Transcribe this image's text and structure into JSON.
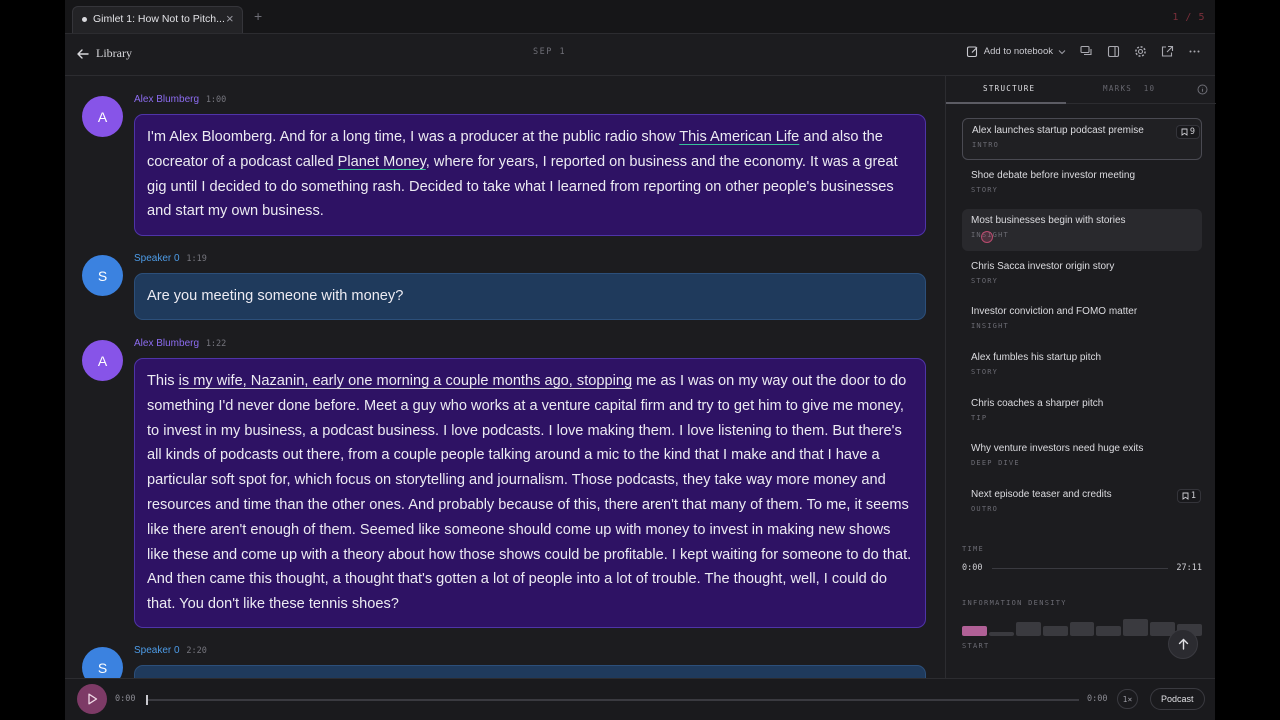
{
  "tabbar": {
    "tab_title": "Gimlet 1: How Not to Pitch...",
    "close_glyph": "×",
    "new_tab_glyph": "+",
    "page_counter": "1 / 5"
  },
  "header": {
    "back_label": "Library",
    "date": "SEP 1",
    "add_to_notebook": "Add to notebook"
  },
  "transcript": {
    "messages": [
      {
        "speaker": "Alex Blumberg",
        "initial": "A",
        "time": "1:00",
        "parts": [
          "I'm Alex Bloomberg. And for a long time, I was a producer at the public radio show ",
          "This American Life",
          " and also the cocreator of a podcast called ",
          "Planet Money",
          ", where for years, I reported on business and the economy. It was a great gig until I decided to do something rash. Decided to take what I learned from reporting on other people's businesses and start my own business."
        ]
      },
      {
        "speaker": "Speaker 0",
        "initial": "S",
        "time": "1:19",
        "text": "Are you meeting someone with money?"
      },
      {
        "speaker": "Alex Blumberg",
        "initial": "A",
        "time": "1:22",
        "parts": [
          "This ",
          "is my wife, Nazanin, early one morning a couple months ago, stopping",
          " me as I was on my way out the door to do something I'd never done before. Meet a guy who works at a venture capital firm and try to get him to give me money, to invest in my business, a podcast business. I love podcasts. I love making them. I love listening to them. But there's all kinds of podcasts out there, from a couple people talking around a mic to the kind that I make and that I have a particular soft spot for, which focus on storytelling and journalism. Those podcasts, they take way more money and resources and time than the other ones. And probably because of this, there aren't that many of them. To me, it seems like there aren't enough of them. Seemed like someone should come up with money to invest in making new shows like these and come up with a theory about how those shows could be profitable. I kept waiting for someone to do that. And then came this thought, a thought that's gotten a lot of people into a lot of trouble. The thought, well, I could do that. You don't like these tennis shoes?"
        ]
      },
      {
        "speaker": "Speaker 0",
        "initial": "S",
        "time": "2:20"
      }
    ]
  },
  "panel": {
    "tab_structure": "STRUCTURE",
    "tab_marks": "MARKS  10",
    "sections": [
      {
        "title": "Alex launches startup podcast premise",
        "category": "INTRO",
        "marks": "9"
      },
      {
        "title": "Shoe debate before investor meeting",
        "category": "STORY"
      },
      {
        "title": "Most businesses begin with stories",
        "category": "INSIGHT"
      },
      {
        "title": "Chris Sacca investor origin story",
        "category": "STORY"
      },
      {
        "title": "Investor conviction and FOMO matter",
        "category": "INSIGHT"
      },
      {
        "title": "Alex fumbles his startup pitch",
        "category": "STORY"
      },
      {
        "title": "Chris coaches a sharper pitch",
        "category": "TIP"
      },
      {
        "title": "Why venture investors need huge exits",
        "category": "DEEP DIVE"
      },
      {
        "title": "Next episode teaser and credits",
        "category": "OUTRO",
        "marks": "1"
      }
    ],
    "time_label": "TIME",
    "time_start": "0:00",
    "time_end": "27:11",
    "density_label": "INFORMATION DENSITY",
    "density_start": "START",
    "density_values": [
      0.55,
      0.2,
      0.75,
      0.55,
      0.8,
      0.55,
      0.95,
      0.8,
      0.65
    ],
    "accent": "#b06096"
  },
  "player": {
    "current": "0:00",
    "duration": "0:00",
    "progress": 0,
    "speed": "1×",
    "mode": "Podcast"
  },
  "colors": {
    "alex_bubble": "#2e1264",
    "speaker_bubble": "#1f3a5c",
    "play_button": "#7d3a66"
  }
}
